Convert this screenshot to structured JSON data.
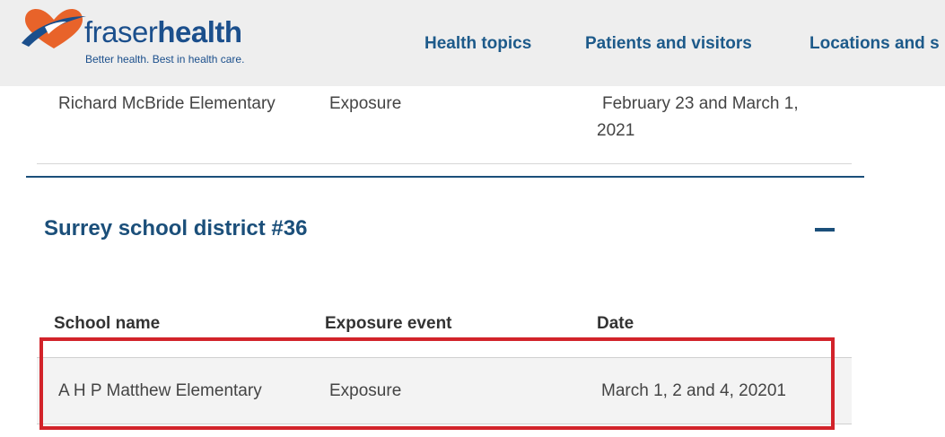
{
  "header": {
    "logo": {
      "name_part1": "fraser",
      "name_part2": "health",
      "tagline": "Better health. Best in health care."
    },
    "nav": [
      {
        "label": "Health topics"
      },
      {
        "label": "Patients and visitors"
      },
      {
        "label": "Locations and s"
      }
    ]
  },
  "previous_row": {
    "school": "Richard McBride Elementary",
    "event": "Exposure",
    "date": "February 23 and March 1, 2021"
  },
  "section": {
    "title": "Surrey school district #36",
    "toggle_icon": "minus-icon"
  },
  "table": {
    "headers": [
      "School name",
      "Exposure event",
      "Date"
    ],
    "rows": [
      {
        "school": "A H P Matthew Elementary",
        "event": "Exposure",
        "date": "March 1, 2 and 4, 20201"
      }
    ]
  },
  "colors": {
    "brand_blue": "#1b4f7a",
    "nav_blue": "#1d5a8a",
    "highlight_red": "#d2232a",
    "logo_orange": "#e8632a"
  }
}
